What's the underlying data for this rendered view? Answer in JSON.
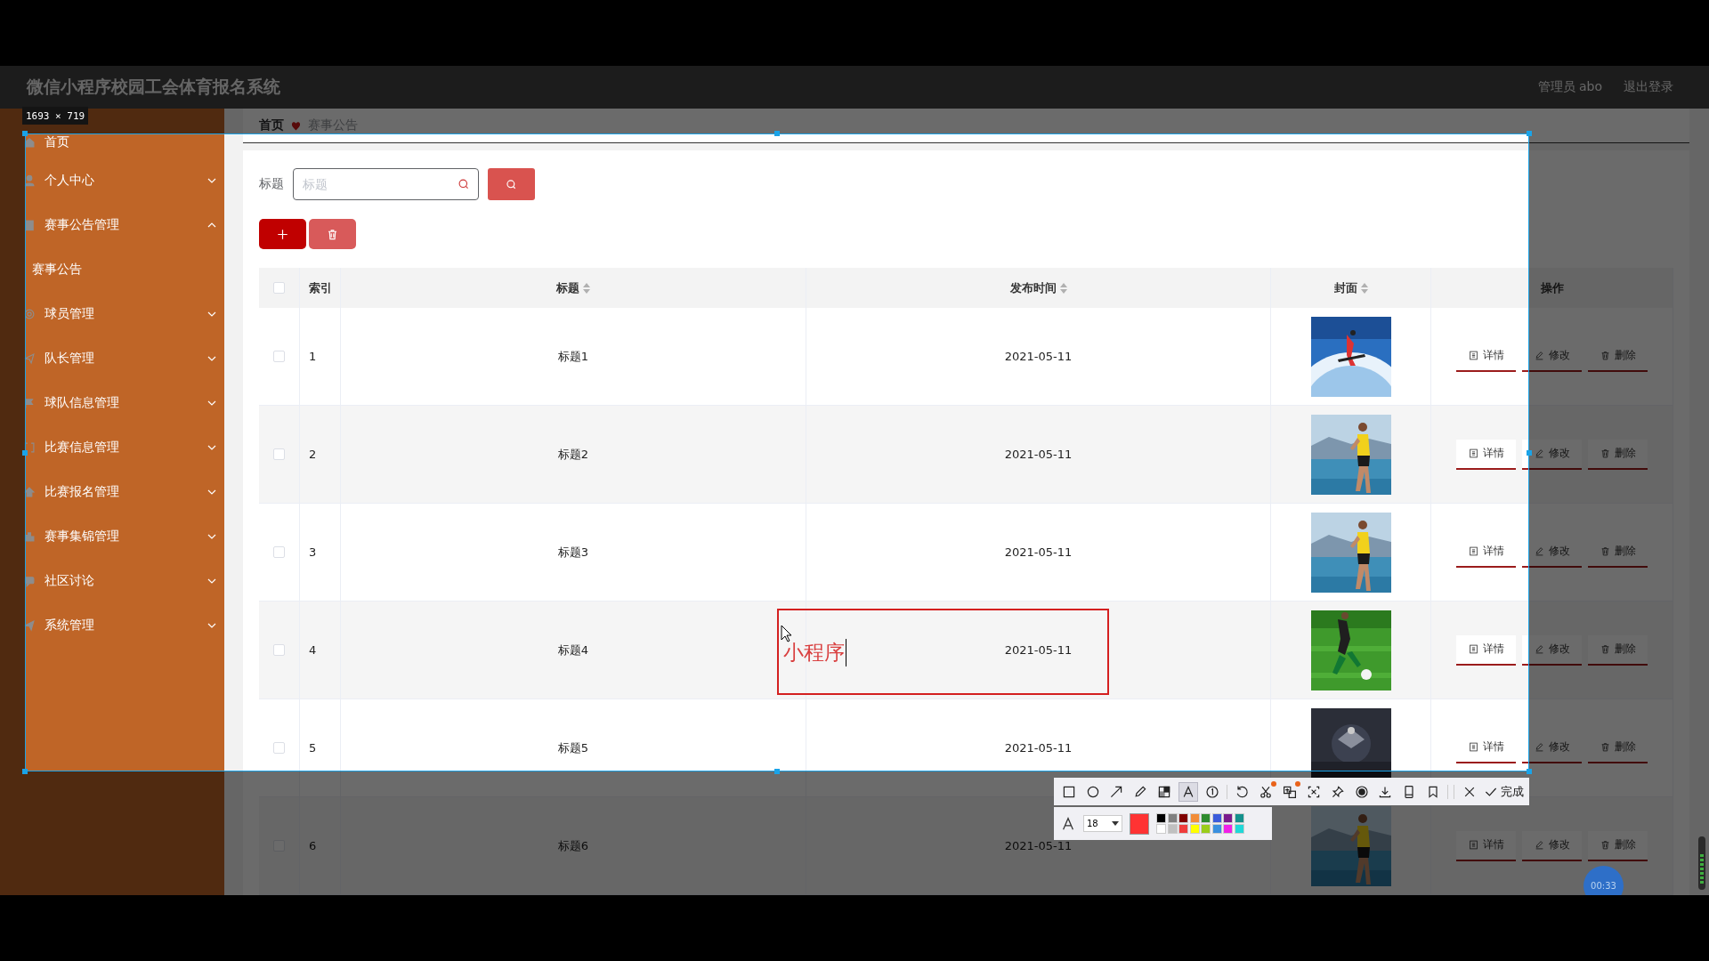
{
  "app": {
    "title": "微信小程序校园工会体育报名系统",
    "user": "管理员 abo",
    "logout": "退出登录"
  },
  "sidebar": {
    "items": [
      {
        "label": "首页",
        "kind": "link"
      },
      {
        "label": "个人中心",
        "kind": "menu",
        "expanded": false
      },
      {
        "label": "赛事公告管理",
        "kind": "menu",
        "expanded": true,
        "children": [
          {
            "label": "赛事公告"
          }
        ]
      },
      {
        "label": "球员管理",
        "kind": "menu",
        "expanded": false
      },
      {
        "label": "队长管理",
        "kind": "menu",
        "expanded": false
      },
      {
        "label": "球队信息管理",
        "kind": "menu",
        "expanded": false
      },
      {
        "label": "比赛信息管理",
        "kind": "menu",
        "expanded": false
      },
      {
        "label": "比赛报名管理",
        "kind": "menu",
        "expanded": false
      },
      {
        "label": "赛事集锦管理",
        "kind": "menu",
        "expanded": false
      },
      {
        "label": "社区讨论",
        "kind": "menu",
        "expanded": false
      },
      {
        "label": "系统管理",
        "kind": "menu",
        "expanded": false
      }
    ]
  },
  "breadcrumb": [
    "首页",
    "赛事公告"
  ],
  "search": {
    "label": "标题",
    "placeholder": "标题"
  },
  "buttons": [
    {
      "kind": "add"
    },
    {
      "kind": "delete"
    }
  ],
  "table": {
    "header_checked": false,
    "columns": [
      {
        "label": "索引",
        "sortable": false
      },
      {
        "label": "标题",
        "sortable": true
      },
      {
        "label": "发布时间",
        "sortable": true
      },
      {
        "label": "封面",
        "sortable": true
      },
      {
        "label": "操作",
        "sortable": false
      }
    ],
    "rows": [
      {
        "checked": false,
        "index": "1",
        "title": "标题1",
        "date": "2021-05-11",
        "actions": [
          {
            "kind": "detail",
            "label": "详情"
          },
          {
            "kind": "edit",
            "label": "修改"
          },
          {
            "kind": "delete",
            "label": "删除"
          }
        ]
      },
      {
        "checked": false,
        "index": "2",
        "title": "标题2",
        "date": "2021-05-11",
        "actions": [
          {
            "kind": "detail",
            "label": "详情"
          },
          {
            "kind": "edit",
            "label": "修改"
          },
          {
            "kind": "delete",
            "label": "删除"
          }
        ]
      },
      {
        "checked": false,
        "index": "3",
        "title": "标题3",
        "date": "2021-05-11",
        "actions": [
          {
            "kind": "detail",
            "label": "详情"
          },
          {
            "kind": "edit",
            "label": "修改"
          },
          {
            "kind": "delete",
            "label": "删除"
          }
        ]
      },
      {
        "checked": false,
        "index": "4",
        "title": "标题4",
        "date": "2021-05-11",
        "actions": [
          {
            "kind": "detail",
            "label": "详情"
          },
          {
            "kind": "edit",
            "label": "修改"
          },
          {
            "kind": "delete",
            "label": "删除"
          }
        ]
      },
      {
        "checked": false,
        "index": "5",
        "title": "标题5",
        "date": "2021-05-11",
        "actions": [
          {
            "kind": "detail",
            "label": "详情"
          },
          {
            "kind": "edit",
            "label": "修改"
          },
          {
            "kind": "delete",
            "label": "删除"
          }
        ]
      },
      {
        "checked": false,
        "index": "6",
        "title": "标题6",
        "date": "2021-05-11",
        "actions": [
          {
            "kind": "detail",
            "label": "详情"
          },
          {
            "kind": "edit",
            "label": "修改"
          },
          {
            "kind": "delete",
            "label": "删除"
          }
        ]
      }
    ]
  },
  "capture": {
    "size": "1693 × 719",
    "annotation": "小程序",
    "tools": [
      {
        "kind": "rect",
        "selected": false,
        "badge": false
      },
      {
        "kind": "ellipse",
        "selected": false,
        "badge": false
      },
      {
        "kind": "arrow",
        "selected": false,
        "badge": false
      },
      {
        "kind": "pencil",
        "selected": false,
        "badge": false
      },
      {
        "kind": "mosaic",
        "selected": false,
        "badge": false
      },
      {
        "kind": "text",
        "selected": true,
        "badge": false
      },
      {
        "kind": "number",
        "selected": false,
        "badge": false
      },
      {
        "kind": "undo",
        "selected": false,
        "badge": false
      },
      {
        "kind": "cut",
        "selected": false,
        "badge": true
      },
      {
        "kind": "translate",
        "selected": false,
        "badge": true
      },
      {
        "kind": "ocr",
        "selected": false,
        "badge": false
      },
      {
        "kind": "pin",
        "selected": false,
        "badge": false
      },
      {
        "kind": "record",
        "selected": false,
        "badge": false
      },
      {
        "kind": "download",
        "selected": false,
        "badge": false
      },
      {
        "kind": "phone",
        "selected": false,
        "badge": false
      },
      {
        "kind": "bookmark",
        "selected": false,
        "badge": false
      },
      {
        "kind": "close",
        "selected": false,
        "badge": false
      }
    ],
    "done": "完成",
    "font_size": "18",
    "current_swatch": {
      "color": "#ff3333"
    },
    "swatches": [
      {
        "color": "#000000"
      },
      {
        "color": "#808080"
      },
      {
        "color": "#800000"
      },
      {
        "color": "#f28c38"
      },
      {
        "color": "#2e8b2e"
      },
      {
        "color": "#3b5bdb"
      },
      {
        "color": "#7b1a8c"
      },
      {
        "color": "#14918c"
      },
      {
        "color": "#ffffff"
      },
      {
        "color": "#c0c0c0"
      },
      {
        "color": "#f03c3c"
      },
      {
        "color": "#ffff00"
      },
      {
        "color": "#9acd1a"
      },
      {
        "color": "#3a8fdf"
      },
      {
        "color": "#f020e8"
      },
      {
        "color": "#20d8d8"
      }
    ],
    "timer": "00:33"
  }
}
